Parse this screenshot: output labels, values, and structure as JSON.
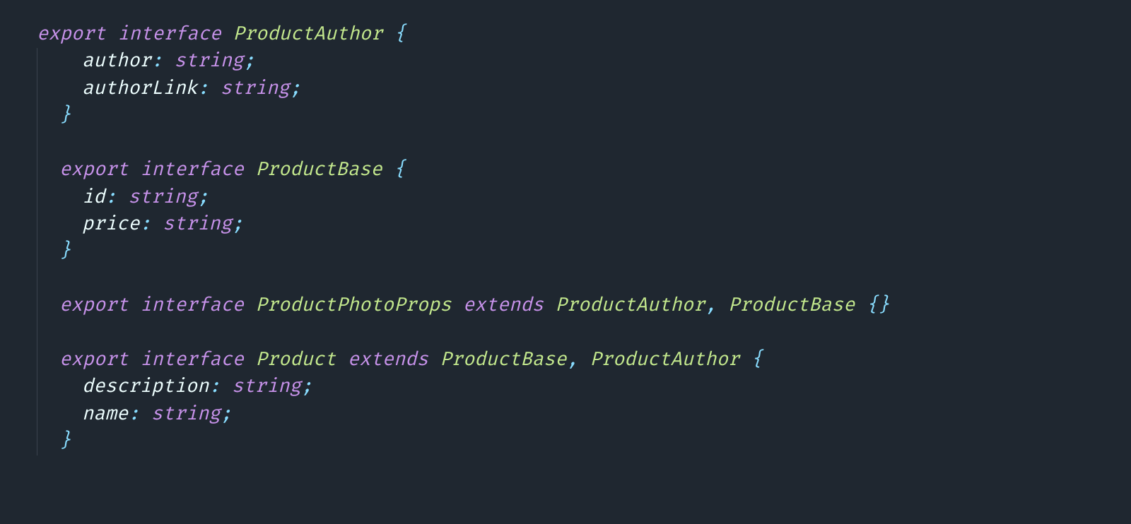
{
  "code": {
    "kw_export": "export",
    "kw_interface": "interface",
    "kw_extends": "extends",
    "type_string": "string",
    "iface1_name": "ProductAuthor",
    "iface1_p1": "author",
    "iface1_p2": "authorLink",
    "iface2_name": "ProductBase",
    "iface2_p1": "id",
    "iface2_p2": "price",
    "iface3_name": "ProductPhotoProps",
    "iface3_ext1": "ProductAuthor",
    "iface3_ext2": "ProductBase",
    "iface4_name": "Product",
    "iface4_ext1": "ProductBase",
    "iface4_ext2": "ProductAuthor",
    "iface4_p1": "description",
    "iface4_p2": "name",
    "brace_open": "{",
    "brace_close": "}",
    "brace_empty": "{}",
    "colon": ":",
    "semi": ";",
    "comma": ","
  },
  "colors": {
    "background": "#1f2730",
    "keyword": "#c792ea",
    "typename": "#c3e88d",
    "identifier": "#eeffff",
    "punctuation": "#89ddff",
    "indent_guide": "#3a434d"
  }
}
